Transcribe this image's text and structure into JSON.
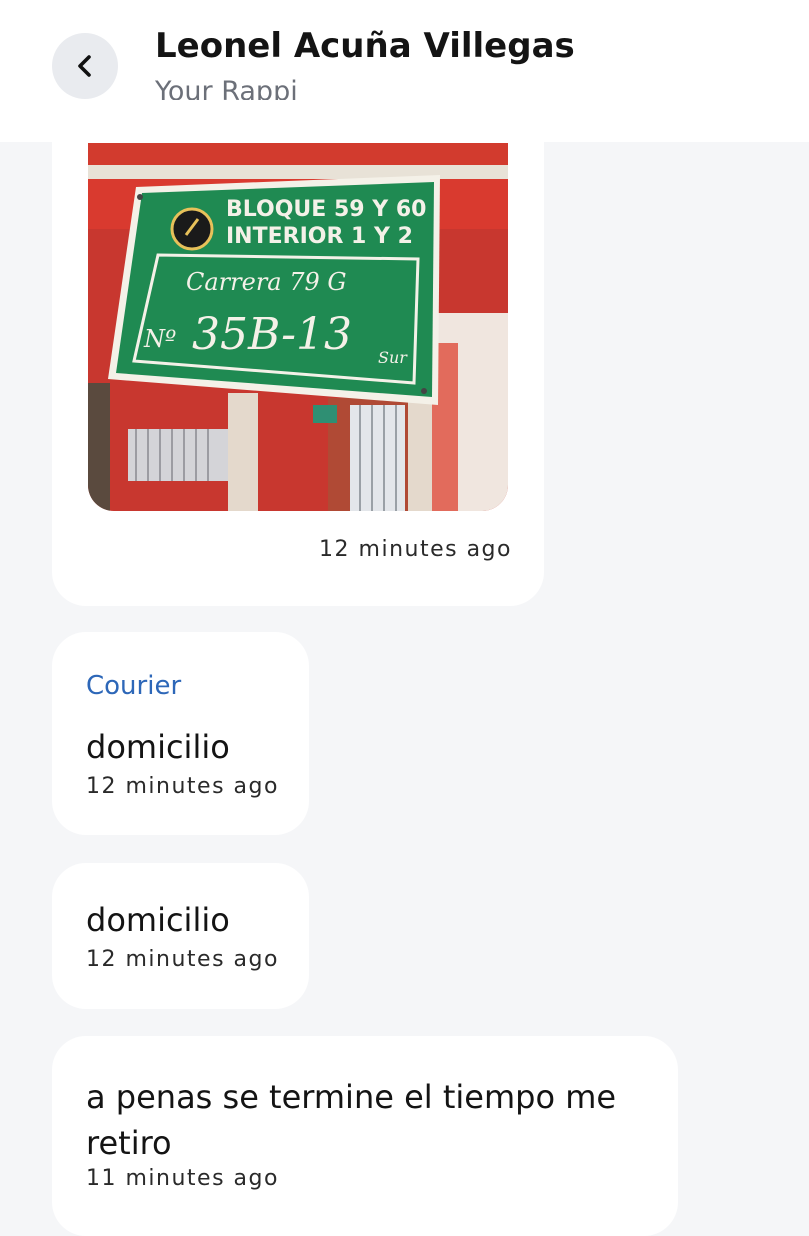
{
  "header": {
    "back_icon": "chevron-left-icon",
    "title": "Leonel Acuña Villegas",
    "subtitle": "Your Rappi"
  },
  "messages": [
    {
      "type": "image",
      "image": {
        "sign_line1": "BLOQUE 59 Y 60",
        "sign_line2": "INTERIOR 1 Y 2",
        "sign_street": "Carrera 79 G",
        "sign_number_prefix": "Nº",
        "sign_number": "35B-13",
        "sign_suffix": "Sur"
      },
      "time": "12 minutes ago"
    },
    {
      "type": "text",
      "sender": "Courier",
      "text": "domicilio",
      "time": "12 minutes ago"
    },
    {
      "type": "text",
      "text": "domicilio",
      "time": "12 minutes ago"
    },
    {
      "type": "text",
      "text": "a penas se termine el tiempo me retiro",
      "time": "11 minutes ago"
    }
  ],
  "colors": {
    "background": "#f5f6f8",
    "bubble": "#ffffff",
    "sender_link": "#2d67b8",
    "sign_green": "#1f8a52"
  }
}
